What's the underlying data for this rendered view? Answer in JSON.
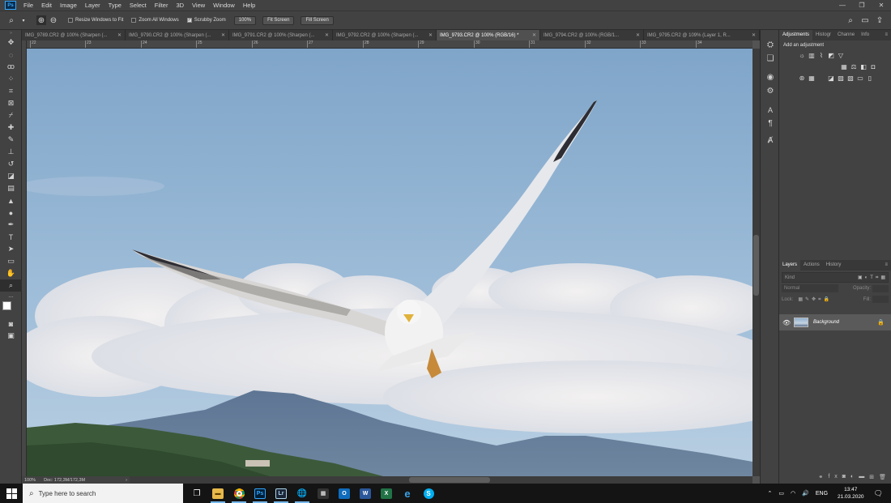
{
  "menu": {
    "logo": "Ps",
    "items": [
      "File",
      "Edit",
      "Image",
      "Layer",
      "Type",
      "Select",
      "Filter",
      "3D",
      "View",
      "Window",
      "Help"
    ]
  },
  "options": {
    "resize_windows": "Resize Windows to Fit",
    "zoom_all": "Zoom All Windows",
    "scrubby_zoom": "Scrubby Zoom",
    "zoom_value": "100%",
    "fit_screen": "Fit Screen",
    "fill_screen": "Fill Screen"
  },
  "tabs": [
    {
      "label": "IMG_9789.CR2 @ 100% (Sharpen (...",
      "active": false
    },
    {
      "label": "IMG_9790.CR2 @ 100% (Sharpen (...",
      "active": false
    },
    {
      "label": "IMG_9791.CR2 @ 100% (Sharpen (...",
      "active": false
    },
    {
      "label": "IMG_9792.CR2 @ 100% (Sharpen (...",
      "active": false
    },
    {
      "label": "IMG_9793.CR2 @ 100% (RGB/16) *",
      "active": true
    },
    {
      "label": "IMG_9794.CR2 @ 100% (RGB/1...",
      "active": false
    },
    {
      "label": "IMG_9795.CR2 @ 109% (Layer 1, R...",
      "active": false
    }
  ],
  "ruler_marks": [
    "22",
    "23",
    "24",
    "25",
    "26",
    "27",
    "28",
    "29",
    "30",
    "31",
    "32",
    "33",
    "34"
  ],
  "status": {
    "zoom": "100%",
    "doc": "Doc: 172,3M/172,3M"
  },
  "adjustments": {
    "tabs": [
      "Adjustments",
      "Histogr",
      "Channe",
      "Info"
    ],
    "add_label": "Add an adjustment"
  },
  "layers": {
    "tabs": [
      "Layers",
      "Actions",
      "History"
    ],
    "kind_placeholder": "Kind",
    "blend_mode": "Normal",
    "opacity_label": "Opacity:",
    "lock_label": "Lock:",
    "fill_label": "Fill:",
    "background_layer": "Background"
  },
  "taskbar": {
    "search_placeholder": "Type here to search",
    "lang": "ENG",
    "time": "13:47",
    "date": "21.03.2020"
  }
}
